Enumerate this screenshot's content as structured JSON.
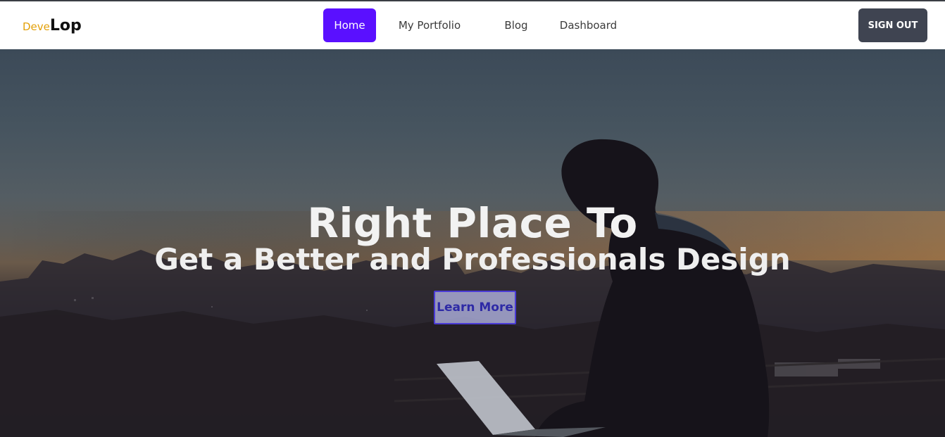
{
  "brand": {
    "part1": "Deve",
    "part2": "Lop"
  },
  "nav": {
    "items": [
      {
        "label": "Home",
        "active": true
      },
      {
        "label": "My Portfolio"
      },
      {
        "label": "Blog"
      },
      {
        "label": "Dashboard"
      }
    ],
    "sign_out": "SIGN OUT"
  },
  "hero": {
    "title": "Right Place To",
    "subtitle": "Get a Better and Professionals Design",
    "cta": "Learn More"
  },
  "colors": {
    "accent": "#5a10ff",
    "brand_part1": "#e3a008",
    "sign_out_bg": "#3f4451",
    "cta_text": "#2e2aa6"
  }
}
